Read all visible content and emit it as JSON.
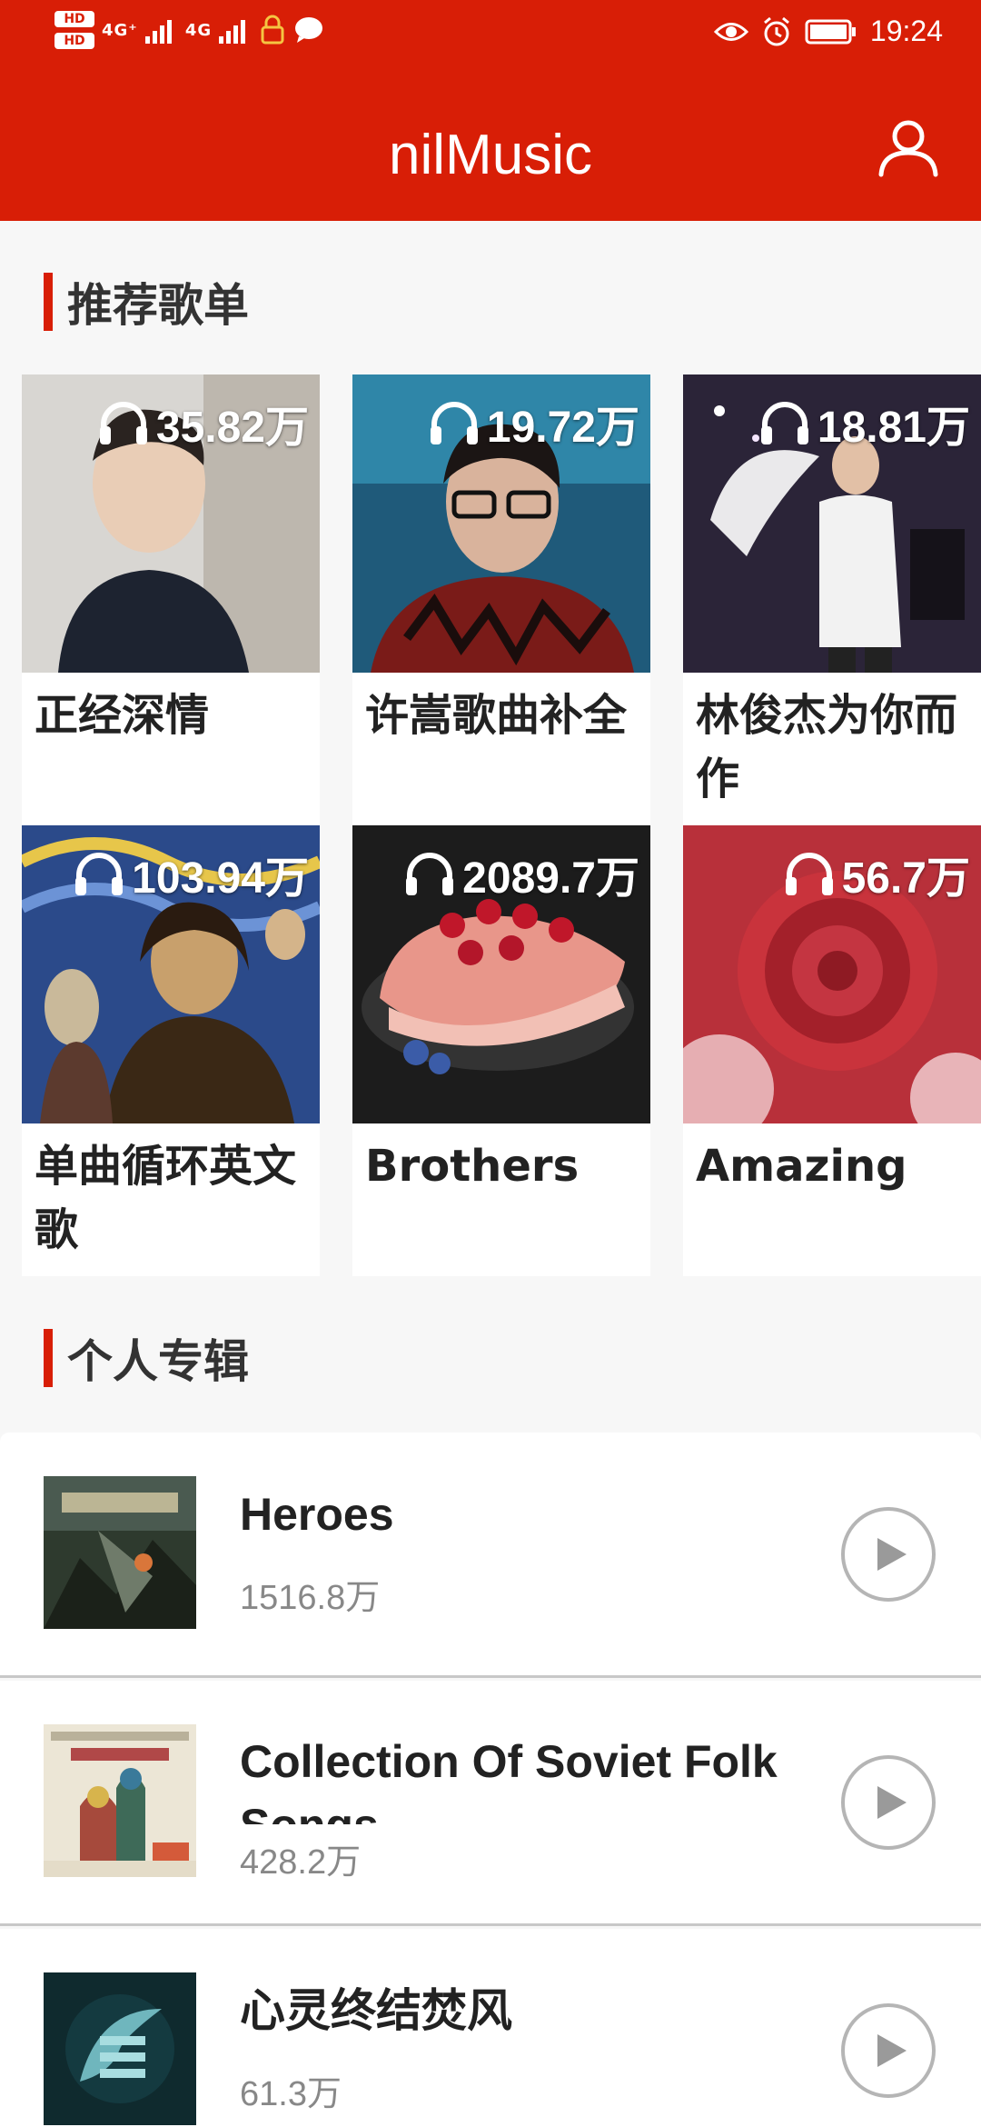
{
  "status_bar": {
    "hd1": "HD",
    "hd2": "HD",
    "net1": "4G⁺",
    "net2": "4G",
    "time": "19:24"
  },
  "header": {
    "title": "nilMusic",
    "user_icon": "user-icon",
    "background": "#d81e06"
  },
  "recommend": {
    "heading": "推荐歌单",
    "items": [
      {
        "name": "正经深情",
        "plays": "35.82万"
      },
      {
        "name": "许嵩歌曲补全",
        "plays": "19.72万"
      },
      {
        "name": "林俊杰为你而作",
        "plays": "18.81万"
      },
      {
        "name": "单曲循环英文歌",
        "plays": "103.94万"
      },
      {
        "name": "Brothers",
        "plays": "2089.7万"
      },
      {
        "name": "Amazing",
        "plays": "56.7万"
      }
    ]
  },
  "albums": {
    "heading": "个人专辑",
    "items": [
      {
        "title": "Heroes",
        "count": "1516.8万"
      },
      {
        "title": "Collection Of Soviet Folk Songs",
        "count": "428.2万"
      },
      {
        "title": "心灵终结焚风",
        "count": "61.3万"
      }
    ]
  }
}
